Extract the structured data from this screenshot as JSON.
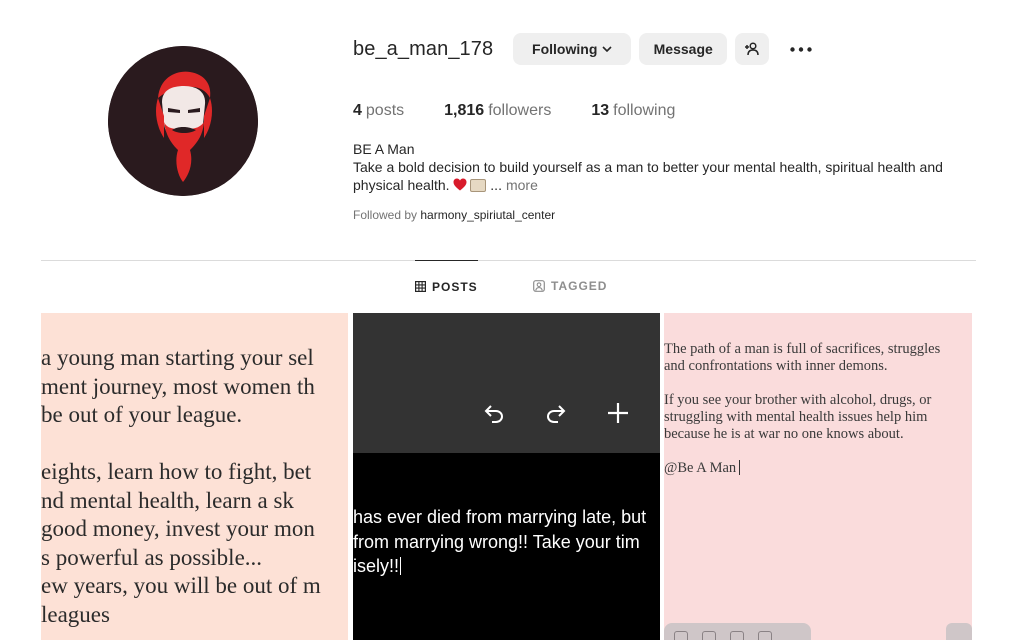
{
  "profile": {
    "username": "be_a_man_178",
    "following_button": "Following",
    "message_button": "Message",
    "stats": {
      "posts_count": "4",
      "posts_label": "posts",
      "followers_count": "1,816",
      "followers_label": "followers",
      "following_count": "13",
      "following_label": "following"
    },
    "bio": {
      "name": "BE A Man",
      "text": "Take a bold decision to build yourself as a man to better your mental health, spiritual health and physical health.",
      "ellipsis": "...",
      "more": "more"
    },
    "followed_by_label": "Followed by",
    "followed_by_user": "harmony_spiriutal_center"
  },
  "tabs": {
    "posts": "POSTS",
    "tagged": "TAGGED"
  },
  "posts": [
    {
      "lines": [
        "a young man starting your sel",
        "ment journey, most women th",
        "be out of your league.",
        "",
        "eights, learn how to fight, bet",
        "nd mental health, learn a sk",
        "good money, invest your mon",
        "s powerful as possible...",
        "ew years, you will be out of m",
        "leagues"
      ]
    },
    {
      "lines": [
        "has ever died from marrying late, but",
        " from marrying wrong!! Take your tim",
        "isely!!"
      ]
    },
    {
      "lines": [
        "The path of a man is full of sacrifices, struggles",
        "and confrontations with inner demons.",
        "If you see your brother with alcohol, drugs, or",
        "struggling with mental health issues help him",
        "because he is at war no one knows about.",
        "@Be A Man"
      ]
    }
  ],
  "colors": {
    "button_bg": "#efefef",
    "text_primary": "#262626",
    "text_secondary": "#737373",
    "post1_bg": "#fde1d6",
    "post3_bg": "#fadcdc",
    "avatar_bg": "#2a1a1e",
    "avatar_red": "#e02828"
  },
  "icons": {
    "following_chevron": "chevron-down-icon",
    "add_user": "add-user-icon",
    "more": "more-options-icon",
    "posts_tab": "grid-icon",
    "tagged_tab": "tagged-user-icon",
    "undo": "undo-icon",
    "redo": "redo-icon",
    "plus": "plus-icon"
  }
}
